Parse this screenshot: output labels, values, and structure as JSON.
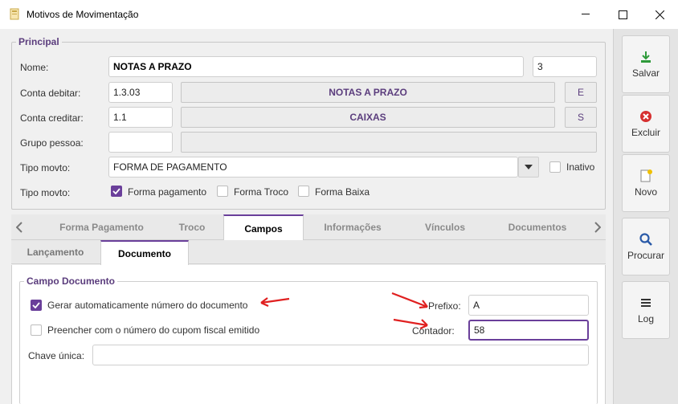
{
  "window": {
    "title": "Motivos de Movimentação",
    "minimize": "—",
    "maximize": "☐",
    "close": "✕"
  },
  "principal": {
    "legend": "Principal",
    "nome_label": "Nome:",
    "nome_value": "NOTAS A PRAZO",
    "code_value": "3",
    "conta_debitar_label": "Conta debitar:",
    "conta_debitar_value": "1.3.03",
    "conta_debitar_desc": "NOTAS A PRAZO",
    "conta_debitar_flag": "E",
    "conta_creditar_label": "Conta creditar:",
    "conta_creditar_value": "1.1",
    "conta_creditar_desc": "CAIXAS",
    "conta_creditar_flag": "S",
    "grupo_pessoa_label": "Grupo pessoa:",
    "grupo_pessoa_value": "",
    "grupo_pessoa_desc": "",
    "tipo_movto_label": "Tipo movto:",
    "tipo_movto_value": "FORMA DE PAGAMENTO",
    "inativo_label": "Inativo",
    "inativo_checked": false,
    "tipo_movto2_label": "Tipo movto:",
    "options": [
      {
        "label": "Forma pagamento",
        "checked": true
      },
      {
        "label": "Forma Troco",
        "checked": false
      },
      {
        "label": "Forma Baixa",
        "checked": false
      }
    ]
  },
  "tabs": [
    "Forma Pagamento",
    "Troco",
    "Campos",
    "Informações",
    "Vínculos",
    "Documentos"
  ],
  "active_tab": "Campos",
  "subtabs": [
    "Lançamento",
    "Documento"
  ],
  "active_subtab": "Documento",
  "campo_documento": {
    "legend": "Campo Documento",
    "gerar_label": "Gerar automaticamente número do documento",
    "gerar_checked": true,
    "preencher_label": "Preencher com o número do cupom fiscal emitido",
    "preencher_checked": false,
    "prefixo_label": "Prefixo:",
    "prefixo_value": "A",
    "contador_label": "Contador:",
    "contador_value": "58",
    "chave_label": "Chave única:",
    "chave_value": ""
  },
  "side_buttons": [
    {
      "label": "Salvar",
      "icon": "save-icon"
    },
    {
      "label": "Excluir",
      "icon": "delete-icon"
    },
    {
      "label": "Novo",
      "icon": "new-document-icon"
    },
    {
      "label": "Procurar",
      "icon": "search-icon"
    },
    {
      "label": "Log",
      "icon": "log-icon"
    }
  ],
  "colors": {
    "accent": "#6a3f9a",
    "label_purple": "#5b3d7d",
    "annotation_red": "#e02020"
  }
}
